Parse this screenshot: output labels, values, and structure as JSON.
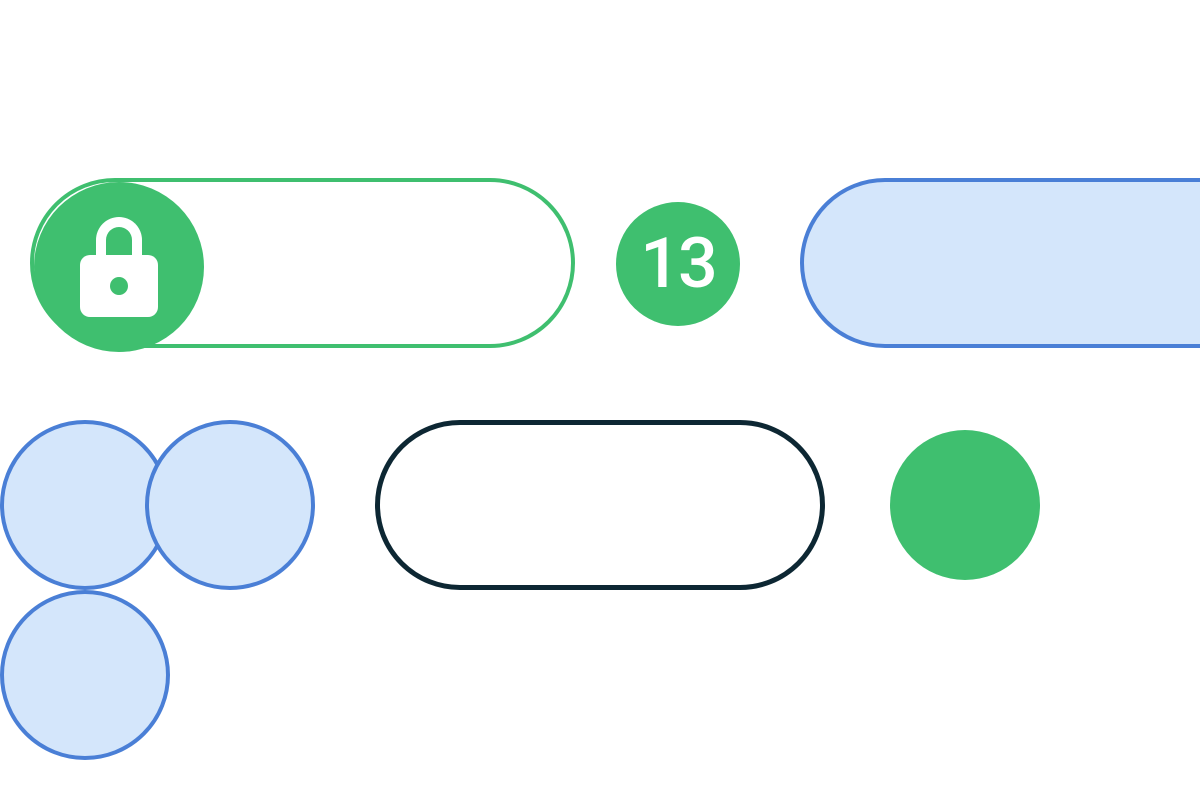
{
  "badge": {
    "number": "13"
  },
  "colors": {
    "green": "#3fbf6f",
    "blue_fill": "#d4e6fb",
    "blue_stroke": "#4a7fd6",
    "dark": "#0d2733",
    "white": "#ffffff"
  }
}
